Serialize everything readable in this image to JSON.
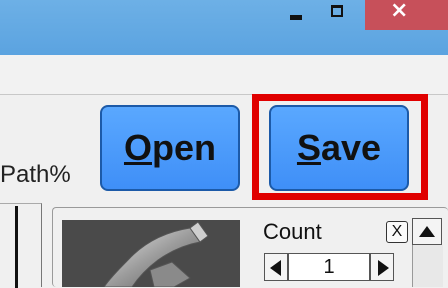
{
  "window": {
    "controls": {
      "minimize_icon": "minimize-icon",
      "maximize_icon": "maximize-icon",
      "close_glyph": "×"
    }
  },
  "toolbar": {
    "path_label": "Path%",
    "open": {
      "accel": "O",
      "rest": "pen"
    },
    "save": {
      "accel": "S",
      "rest": "ave"
    }
  },
  "count_panel": {
    "label": "Count",
    "clear_label": "X",
    "value": "1"
  },
  "colors": {
    "titlebar": "#5ba3e0",
    "close": "#c7505a",
    "button": "#3f8ff7",
    "highlight": "#e00000"
  }
}
